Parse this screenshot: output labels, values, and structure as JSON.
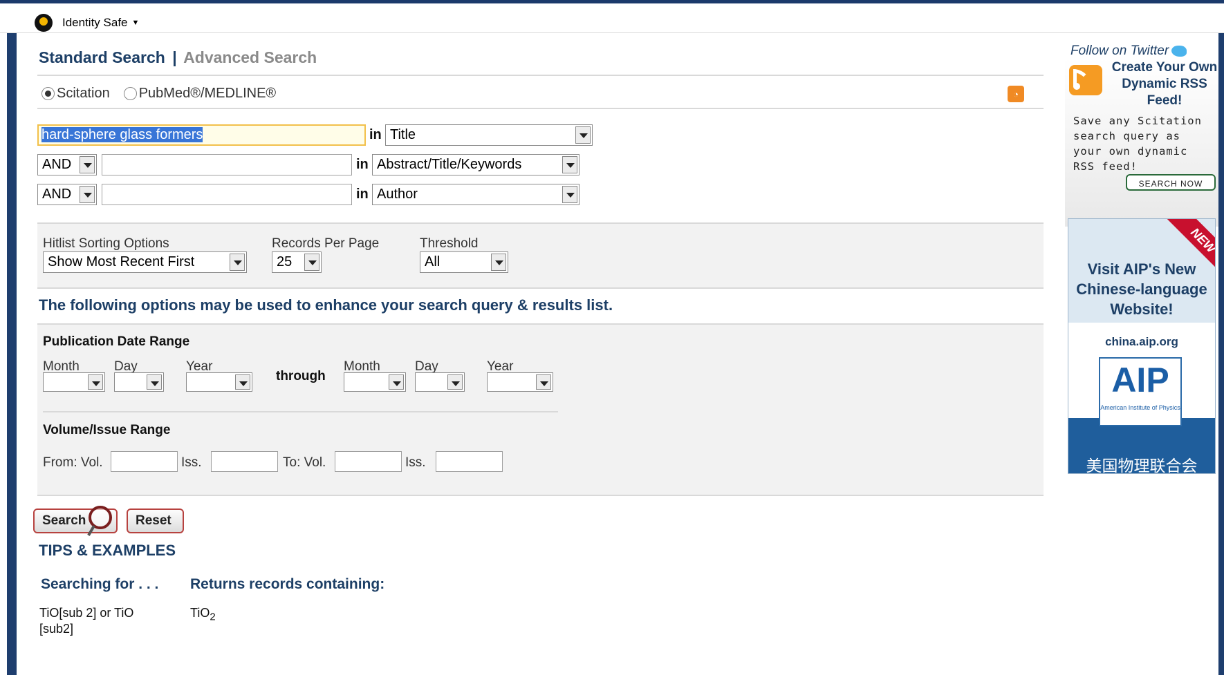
{
  "toolbar": {
    "identity_safe": "Identity Safe"
  },
  "search_tabs": {
    "standard": "Standard Search",
    "separator": "|",
    "advanced": "Advanced Search"
  },
  "sources": {
    "scitation": "Scitation",
    "pubmed": "PubMed®/MEDLINE®",
    "selected": "Scitation"
  },
  "query_rows": [
    {
      "value": "hard-sphere glass formers",
      "in_label": "in",
      "field": "Title"
    },
    {
      "operator": "AND",
      "value": "",
      "in_label": "in",
      "field": "Abstract/Title/Keywords"
    },
    {
      "operator": "AND",
      "value": "",
      "in_label": "in",
      "field": "Author"
    }
  ],
  "options": {
    "sorting_label": "Hitlist Sorting Options",
    "sorting_value": "Show Most Recent First",
    "records_label": "Records Per Page",
    "records_value": "25",
    "threshold_label": "Threshold",
    "threshold_value": "All"
  },
  "enhance_text": "The following options may be used to enhance your search query & results list.",
  "date_range": {
    "title": "Publication Date Range",
    "month": "Month",
    "day": "Day",
    "year": "Year",
    "through": "through"
  },
  "volume_range": {
    "title": "Volume/Issue Range",
    "from_vol": "From: Vol.",
    "iss": "Iss.",
    "to_vol": "To: Vol."
  },
  "buttons": {
    "search": "Search",
    "reset": "Reset"
  },
  "tips": {
    "title": "TIPS & EXAMPLES",
    "col1": "Searching for . . .",
    "col2": "Returns records containing:",
    "example_query": "TiO[sub 2] or TiO [sub2]",
    "example_result_base": "TiO",
    "example_result_sub": "2"
  },
  "sidebar": {
    "follow": "Follow on Twitter",
    "rss_title": "Create Your Own Dynamic RSS Feed!",
    "rss_desc": "Save any Scitation search query as your own dynamic RSS feed!",
    "search_now": "SEARCH NOW",
    "ad_new": "NEW",
    "ad_title": "Visit AIP's New Chinese-language Website!",
    "ad_url": "china.aip.org",
    "ad_logo": "AIP",
    "ad_logo_sub": "American Institute of Physics",
    "ad_chinese": "美国物理联合会"
  },
  "colors": {
    "heading": "#1d3f66",
    "frame": "#1e3e6e",
    "button_border": "#b7423f",
    "rss": "#f08a24"
  }
}
